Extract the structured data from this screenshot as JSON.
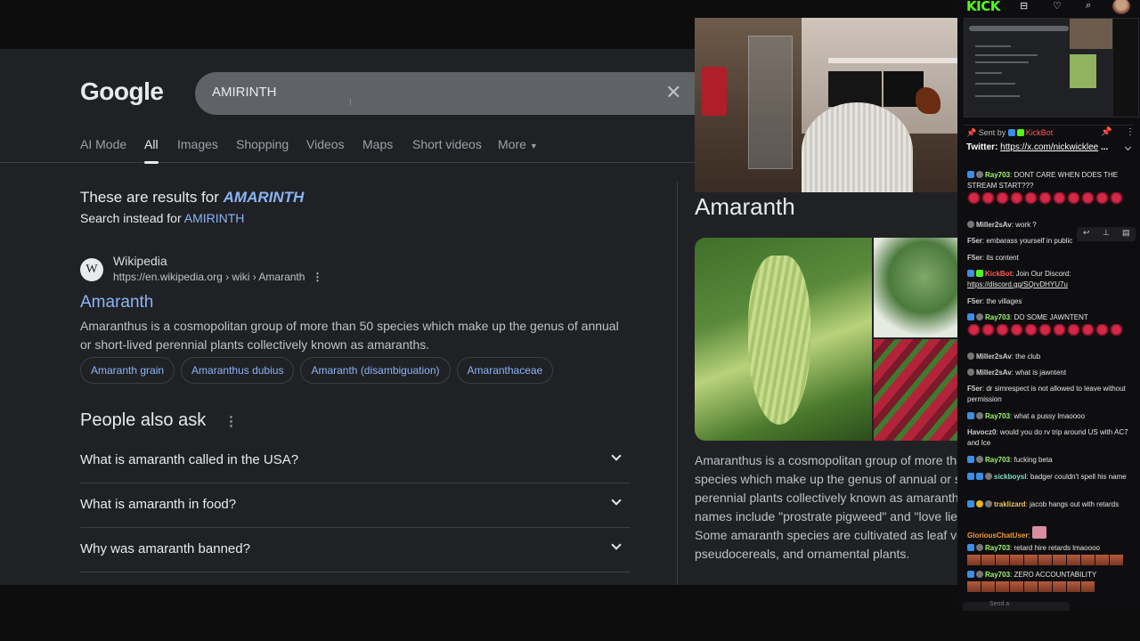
{
  "google": {
    "logo": "Google",
    "query": "AMIRINTH",
    "clear": "✕",
    "tabs": [
      "AI Mode",
      "All",
      "Images",
      "Shopping",
      "Videos",
      "Maps",
      "Short videos",
      "More"
    ],
    "active_tab": "All",
    "correction_prefix": "These are results for ",
    "corrected_term": "AMARINTH",
    "instead_prefix": "Search instead for ",
    "instead_term": "AMIRINTH",
    "result": {
      "favicon": "W",
      "site": "Wikipedia",
      "url": "https://en.wikipedia.org › wiki › Amaranth",
      "dots": "⋮",
      "title": "Amaranth",
      "snippet": "Amaranthus is a cosmopolitan group of more than 50 species which make up the genus of annual or short-lived perennial plants collectively known as amaranths.",
      "chips": [
        "Amaranth grain",
        "Amaranthus dubius",
        "Amaranth (disambiguation)",
        "Amaranthaceae"
      ]
    },
    "paa": {
      "title": "People also ask",
      "dots": "⋮",
      "questions": [
        "What is amaranth called in the USA?",
        "What is amaranth in food?",
        "Why was amaranth banned?"
      ]
    },
    "knowledge_panel": {
      "title": "Amaranth",
      "desc_lines": [
        "Amaranthus is a cosmopolitan group of more than",
        "species which make up the genus of annual or sho",
        "perennial plants collectively known as amaranths.",
        "names include \"prostrate pigweed\" and \"love lies b",
        "Some amaranth species are cultivated as leaf vege",
        "pseudocereals, and ornamental plants."
      ]
    }
  },
  "kick": {
    "logo": "KICK",
    "icons": {
      "gift": "⊟",
      "heart": "♡",
      "search": "⌕"
    },
    "pinned": {
      "sent_by": "Sent by",
      "sender": "KickBot",
      "prefix": "Twitter: ",
      "link": "https://x.com/nickwicklee",
      "ellipsis": " ..."
    },
    "messages": [
      {
        "user": "Ray703",
        "text": ": DONT CARE WHEN DOES THE STREAM START???"
      },
      {
        "user": "Miller2sAv",
        "text": ": work ?"
      },
      {
        "user": "F5er",
        "text": ": embarass yourself in public"
      },
      {
        "user": "F5er",
        "text": ": its content"
      },
      {
        "user": "KickBot",
        "text": ": Join Our Discord:",
        "link": "https://discord.gg/SQrvDHYU7u"
      },
      {
        "user": "F5er",
        "text": ": the villages"
      },
      {
        "user": "Ray703",
        "text": ": DO SOME JAWNTENT"
      },
      {
        "user": "Miller2sAv",
        "text": ": the club"
      },
      {
        "user": "Miller2sAv",
        "text": ": what is jawntent"
      },
      {
        "user": "F5er",
        "text": ": dr simrespect is not allowed to leave without permission"
      },
      {
        "user": "Ray703",
        "text": ": what a pussy lmaoooo"
      },
      {
        "user": "Havocz0",
        "text": ": would you do rv trip around US with AC7 and Ice"
      },
      {
        "user": "Ray703",
        "text": ": fucking beta"
      },
      {
        "user": "sickboysl",
        "text": ": badger couldn't spell his name"
      },
      {
        "user": "traklizard",
        "text": ": jacob hangs out with retards"
      },
      {
        "user": "GloriousChatUser",
        "text": ":"
      },
      {
        "user": "Ray703",
        "text": ": retard hire retards lmaoooo"
      },
      {
        "user": "Ray703",
        "text": ": ZERO ACCOUNTABILITY"
      }
    ],
    "send_placeholder": "Send a"
  },
  "colors": {
    "google_bg": "#202124",
    "link": "#8ab4f8",
    "kick_green": "#53fc18",
    "chat_bg": "#0e0e10"
  }
}
